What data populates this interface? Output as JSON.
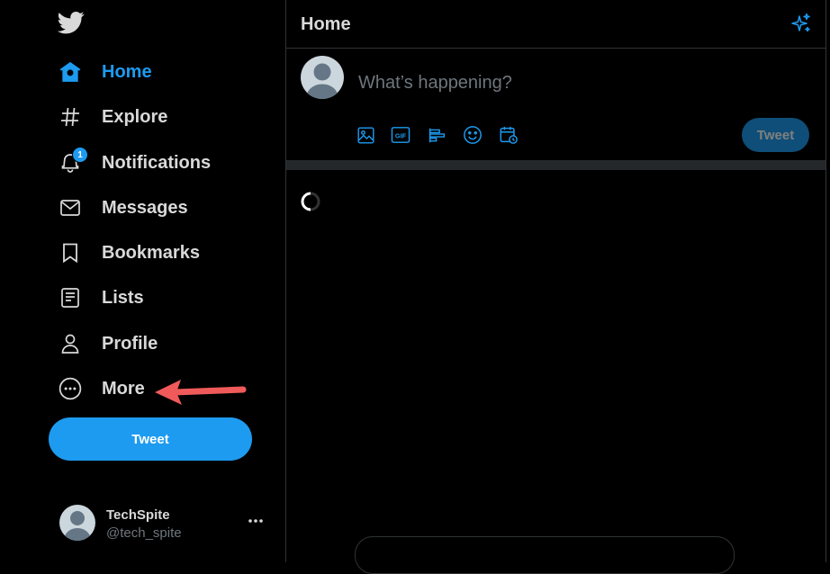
{
  "sidebar": {
    "logo": "twitter-bird-icon",
    "items": [
      {
        "label": "Home",
        "icon": "home-icon",
        "active": true
      },
      {
        "label": "Explore",
        "icon": "hashtag-icon"
      },
      {
        "label": "Notifications",
        "icon": "bell-icon",
        "badge": "1"
      },
      {
        "label": "Messages",
        "icon": "envelope-icon"
      },
      {
        "label": "Bookmarks",
        "icon": "bookmark-icon"
      },
      {
        "label": "Lists",
        "icon": "list-icon"
      },
      {
        "label": "Profile",
        "icon": "person-icon"
      },
      {
        "label": "More",
        "icon": "more-circle-icon"
      }
    ],
    "tweet_label": "Tweet",
    "account": {
      "name": "TechSpite",
      "handle": "@tech_spite"
    }
  },
  "header": {
    "title": "Home",
    "icon": "sparkle-icon"
  },
  "composer": {
    "placeholder": "What’s happening?",
    "tools": [
      "image-icon",
      "gif-icon",
      "poll-icon",
      "emoji-icon",
      "schedule-icon"
    ],
    "tweet_label": "Tweet"
  },
  "colors": {
    "accent": "#1d9bf0",
    "text": "#d9d9d9",
    "muted": "#6e767d",
    "annotation": "#f05a5a"
  }
}
